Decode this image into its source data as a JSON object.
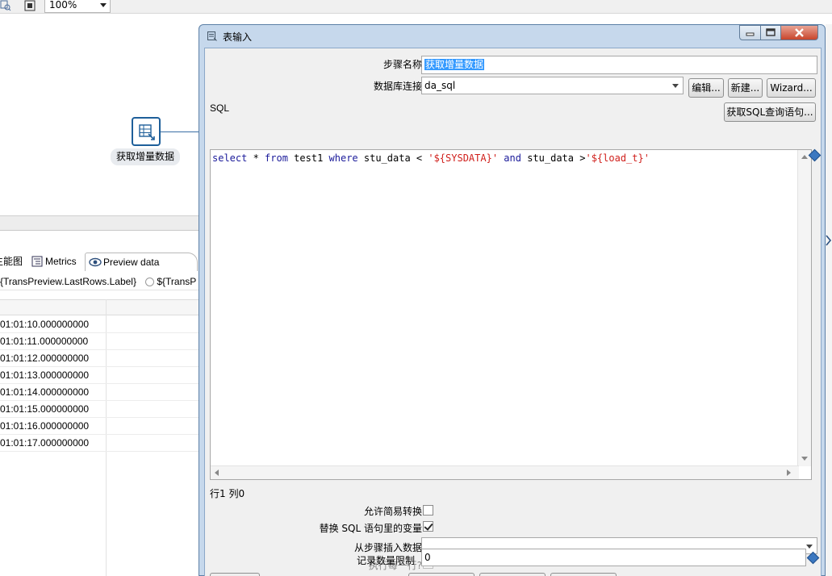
{
  "toolbar": {
    "zoom_value": "100%"
  },
  "canvas": {
    "step_label": "获取增量数据"
  },
  "bottom_panel": {
    "tabs": [
      {
        "label": "性能图",
        "visible_label": "生能图"
      },
      {
        "label": "Metrics"
      },
      {
        "label": "Preview data"
      }
    ],
    "radio_1": "{TransPreview.LastRows.Label}",
    "radio_2": "${TransP",
    "rows": [
      "01:01:10.000000000",
      "01:01:11.000000000",
      "01:01:12.000000000",
      "01:01:13.000000000",
      "01:01:14.000000000",
      "01:01:15.000000000",
      "01:01:16.000000000",
      "01:01:17.000000000"
    ]
  },
  "dialog": {
    "title": "表输入",
    "step_name_label": "步骤名称",
    "step_name_value": "获取增量数据",
    "db_conn_label": "数据库连接",
    "db_conn_value": "da_sql",
    "edit_button": "编辑...",
    "new_button": "新建...",
    "wizard_button": "Wizard...",
    "sql_label": "SQL",
    "get_sql_button": "获取SQL查询语句...",
    "sql": {
      "p1": "select",
      "p2": " * ",
      "p3": "from",
      "p4": " test1 ",
      "p5": "where",
      "p6": " stu_data < ",
      "p7": "'${SYSDATA}'",
      "p8": " ",
      "p9": "and",
      "p10": " stu_data >",
      "p11": "'${load_t}'"
    },
    "cursor_position": "行1 列0",
    "lazy_conversion_label": "允许简易转换",
    "lazy_conversion_checked": false,
    "replace_vars_label": "替换 SQL 语句里的变量",
    "replace_vars_checked": true,
    "insert_from_step_label": "从步骤插入数据",
    "insert_from_step_value": "",
    "execute_each_row_label": "执行每一行?",
    "execute_each_row_checked": false,
    "limit_label": "记录数量限制",
    "limit_value": "0"
  },
  "colors": {
    "selection": "#3399ff",
    "sql_keyword": "#1a1a9a",
    "sql_string": "#d0201c",
    "dialog_frame": "#c6d8ec"
  }
}
